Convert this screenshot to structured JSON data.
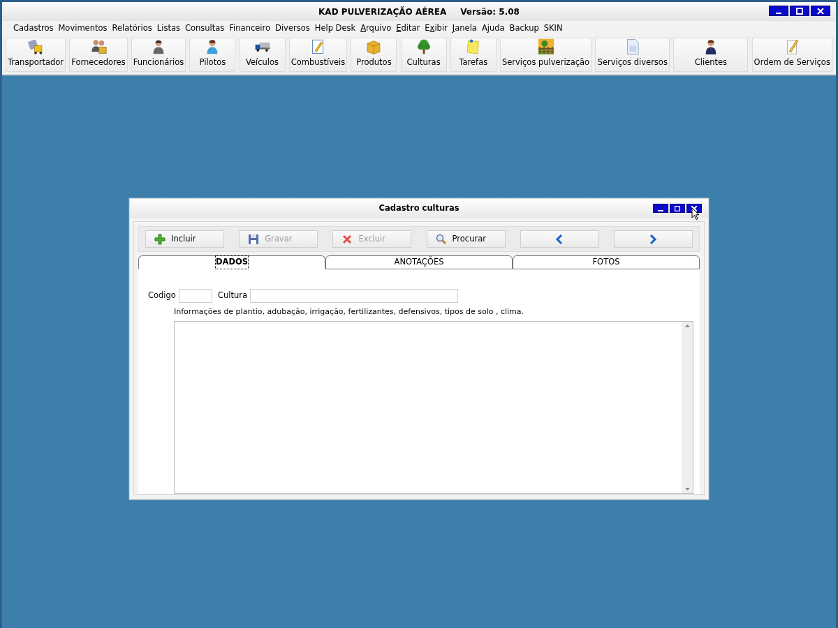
{
  "window": {
    "title": "KAD PULVERIZAÇÃO AÉREA",
    "version": "Versão: 5.08"
  },
  "menu": [
    {
      "label": "Cadastros"
    },
    {
      "label": "Movimentos"
    },
    {
      "label": "Relatórios"
    },
    {
      "label": "Listas"
    },
    {
      "label": "Consultas"
    },
    {
      "label": "Financeiro"
    },
    {
      "label": "Diversos"
    },
    {
      "label": "Help Desk"
    },
    {
      "access_key": "A",
      "rest": "rquivo"
    },
    {
      "access_key": "E",
      "rest": "ditar"
    },
    {
      "before": "E",
      "access_key": "x",
      "rest": "ibir"
    },
    {
      "access_key": "J",
      "rest": "anela"
    },
    {
      "label": "Ajuda"
    },
    {
      "label": "Backup"
    },
    {
      "label": "SKIN"
    }
  ],
  "toolbar": [
    {
      "label": "Transportador"
    },
    {
      "label": "Fornecedores"
    },
    {
      "label": "Funcionários"
    },
    {
      "label": "Pilotos"
    },
    {
      "label": "Veículos"
    },
    {
      "label": "Combustíveis"
    },
    {
      "label": "Produtos"
    },
    {
      "label": "Culturas"
    },
    {
      "label": "Tarefas"
    },
    {
      "label": "Serviços pulverização"
    },
    {
      "label": "Serviços diversos"
    },
    {
      "label": "Clientes"
    },
    {
      "label": "Ordem de Serviços"
    }
  ],
  "dialog": {
    "title": "Cadastro culturas",
    "buttons": [
      {
        "label": "Incluir",
        "disabled": false
      },
      {
        "label": "Gravar",
        "disabled": true
      },
      {
        "label": "Excluir",
        "disabled": true
      },
      {
        "label": "Procurar",
        "disabled": false
      },
      {
        "disabled": false
      },
      {
        "disabled": false
      }
    ],
    "tabs": [
      {
        "label": "DADOS",
        "selected": true
      },
      {
        "label": "ANOTAÇÕES",
        "selected": false
      },
      {
        "label": "FOTOS",
        "selected": false
      }
    ],
    "fields": [
      {
        "label": "Codigo",
        "kind": "short"
      },
      {
        "label": "Cultura",
        "kind": "long"
      }
    ],
    "notes_label": "Informações de plantio, adubação, irrigação, fertilizantes, defensivos, tipos de solo , clima."
  }
}
